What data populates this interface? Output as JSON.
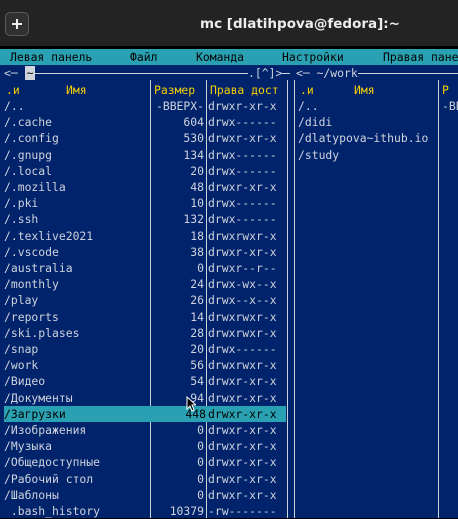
{
  "window": {
    "title": "mc [dlatihpova@fedora]:~"
  },
  "menu": {
    "items": [
      "Левая панель",
      "Файл",
      "Команда",
      "Настройки",
      "Правая панель"
    ]
  },
  "left_panel": {
    "path": "~",
    "marker": "[^]",
    "headers": {
      "flag": ".и",
      "name": "Имя",
      "size": "Размер",
      "perm": "Права дост"
    },
    "rows": [
      {
        "name": "/..",
        "size": "-ВВЕРХ-",
        "perm": "drwxr-xr-x"
      },
      {
        "name": "/.cache",
        "size": "604",
        "perm": "drwx------"
      },
      {
        "name": "/.config",
        "size": "530",
        "perm": "drwxr-xr-x"
      },
      {
        "name": "/.gnupg",
        "size": "134",
        "perm": "drwx------"
      },
      {
        "name": "/.local",
        "size": "20",
        "perm": "drwx------"
      },
      {
        "name": "/.mozilla",
        "size": "48",
        "perm": "drwxr-xr-x"
      },
      {
        "name": "/.pki",
        "size": "10",
        "perm": "drwx------"
      },
      {
        "name": "/.ssh",
        "size": "132",
        "perm": "drwx------"
      },
      {
        "name": "/.texlive2021",
        "size": "18",
        "perm": "drwxrwxr-x"
      },
      {
        "name": "/.vscode",
        "size": "38",
        "perm": "drwxr-xr-x"
      },
      {
        "name": "/australia",
        "size": "0",
        "perm": "drwxr--r--"
      },
      {
        "name": "/monthly",
        "size": "24",
        "perm": "drwx-wx--x"
      },
      {
        "name": "/play",
        "size": "26",
        "perm": "drwx--x--x"
      },
      {
        "name": "/reports",
        "size": "14",
        "perm": "drwxrwxr-x"
      },
      {
        "name": "/ski.plases",
        "size": "28",
        "perm": "drwxrwxr-x"
      },
      {
        "name": "/snap",
        "size": "20",
        "perm": "drwx------"
      },
      {
        "name": "/work",
        "size": "56",
        "perm": "drwxrwxr-x"
      },
      {
        "name": "/Видео",
        "size": "54",
        "perm": "drwxr-xr-x"
      },
      {
        "name": "/Документы",
        "size": "94",
        "perm": "drwxr-xr-x"
      },
      {
        "name": "/Загрузки",
        "size": "448",
        "perm": "drwxr-xr-x",
        "selected": true
      },
      {
        "name": "/Изображения",
        "size": "0",
        "perm": "drwxr-xr-x"
      },
      {
        "name": "/Музыка",
        "size": "0",
        "perm": "drwxr-xr-x"
      },
      {
        "name": "/Общедоступные",
        "size": "0",
        "perm": "drwxr-xr-x"
      },
      {
        "name": "/Рабочий стол",
        "size": "0",
        "perm": "drwxr-xr-x"
      },
      {
        "name": "/Шаблоны",
        "size": "0",
        "perm": "drwxr-xr-x"
      },
      {
        "name": " .bash_history",
        "size": "10379",
        "perm": "-rw-------"
      }
    ]
  },
  "right_panel": {
    "path": "~/work",
    "headers": {
      "flag": ".и",
      "name": "Имя",
      "size_partial": "Р"
    },
    "rows": [
      {
        "name": "/..",
        "size": "-ВВЕ"
      },
      {
        "name": "/didi",
        "size": ""
      },
      {
        "name": "/dlatypova~ithub.io",
        "size": ""
      },
      {
        "name": "/study",
        "size": ""
      }
    ]
  },
  "colors": {
    "panel_bg": "#00236c",
    "accent": "#2aa1b3",
    "header_text": "#f5d000",
    "text": "#cfd3dc"
  },
  "icons": {
    "new_tab": "plus-square-icon",
    "cursor": "mouse-pointer-icon"
  }
}
